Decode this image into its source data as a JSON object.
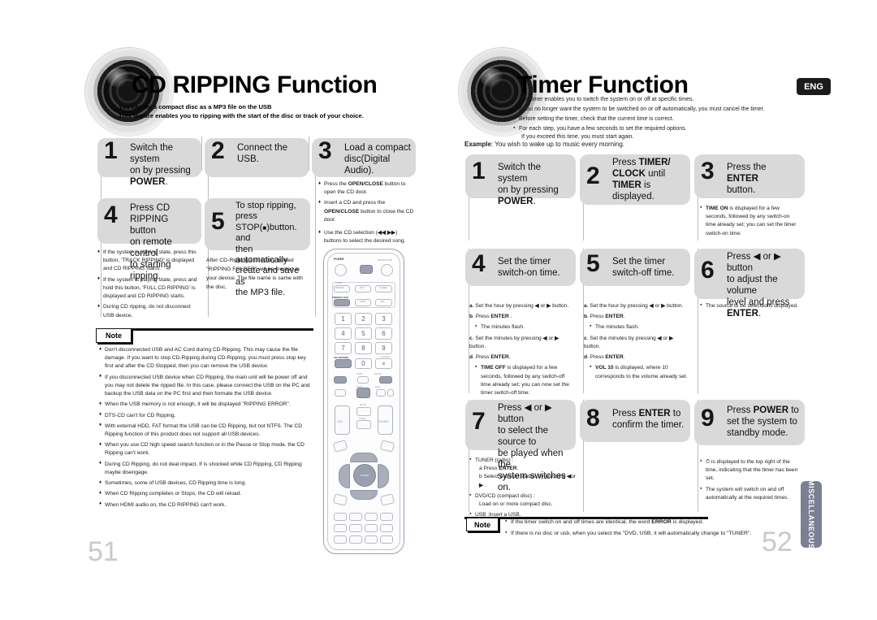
{
  "meta": {
    "lang_badge": "ENG",
    "side_tab": "MISCELLANEOUS"
  },
  "left_page": {
    "number": "51",
    "title": "CD RIPPING Function",
    "lead": [
      "You can rip a compact disc as a MP3 file on the USB",
      "This feature enables you to ripping with the start of the disc or track of your choice."
    ],
    "steps": [
      {
        "num": "1",
        "text": "Switch the system on by pressing POWER.",
        "bold": [
          "POWER"
        ]
      },
      {
        "num": "2",
        "text": "Connect the USB.",
        "bold": []
      },
      {
        "num": "3",
        "text": "Load a compact disc(Digital Audio).",
        "bold": []
      },
      {
        "num": "4",
        "text": "Press CD RIPPING button on remote control to starting ripping.",
        "bold": []
      },
      {
        "num": "5",
        "text": "To stop ripping, press STOP(■)button. and then automatically create and save as the MP3 file.",
        "bold": []
      }
    ],
    "step3_notes": [
      "Press the OPEN/CLOSE button to open the CD door.",
      "Insert a CD and press the OPEN/CLOSE button to close the CD door.",
      "Use the CD selection (◀◀ ▶▶) buttons to select the desired song."
    ],
    "step4_notes": [
      "If the system is playing state, press this button, 'TRACK RIPPING' is displayed and CD RIPPING starts.",
      "If the system is playing state, press and hold this button, 'FULL CD RIPPING' is displayed and CD RIPPING starts.",
      "During CD ripping, do not disconnect USB device."
    ],
    "step5_note": "After CD-Ripping,a directory named \"RIPPING FOLDER\" will be created in your device. The file name is same with the disc.",
    "note_label": "Note",
    "notes": [
      "Don't disconnected USB and AC Cord during CD-Ripping. This may cause the file damage. If you want to stop CD-Ripping during CD-Ripping, you must press stop key first and after the CD Stopped, then you can remove the USB device.",
      "If you disconnected USB device when CD Ripping, the main unit will be power off and you may not delete the ripped file. In this case, please connect the USB on the PC and backup the USB data on the PC first and then formate the USB device.",
      "When the USB memory is not enough, it will be displayed \"RIPPING ERROR\".",
      "DTS-CD can't for CD Ripping.",
      "With external HDD, FAT format the USB can be CD Ripping, but not NTFS. The CD Ripping function of this product does not support all USB devices.",
      "When you use CD high speed search function or in the Pause or Stop mode, the CD Ripping can't work.",
      "During CD Ripping, do not deal impact. If is shocked while CD Ripping, CD Ripping maybe disengage.",
      "Sometimes, some of USB devices, CD Ripping time is long.",
      "When CD Ripping completes or Stops, the CD will reload.",
      "When HDMI audio on, the CD RIPPING can't work."
    ]
  },
  "right_page": {
    "number": "52",
    "title": "Timer Function",
    "lead": [
      "The timer enables you to switch the system on or off at specific times.",
      "If you no longer want the system to be switched on or off automatically, you must cancel the timer.",
      "Before setting the timer, check that the current time is correct.",
      "For each step, you have a few seconds to set the required options.",
      "If you exceed this time, you must start again."
    ],
    "example_label": "Example",
    "example_text": ": You wish to wake up to music every morning.",
    "steps": [
      {
        "num": "1",
        "text": "Switch the system on by pressing POWER."
      },
      {
        "num": "2",
        "text": "Press TIMER/ CLOCK until TIMER is displayed."
      },
      {
        "num": "3",
        "text": "Press the ENTER button."
      },
      {
        "num": "4",
        "text": "Set the timer switch-on time."
      },
      {
        "num": "5",
        "text": "Set the timer switch-off time."
      },
      {
        "num": "6",
        "text": "Press ◀ or ▶ button to adjust the volume level and press ENTER."
      },
      {
        "num": "7",
        "text": "Press ◀ or ▶ button to select the source to be played when the system switches on."
      },
      {
        "num": "8",
        "text": "Press ENTER to confirm the timer."
      },
      {
        "num": "9",
        "text": "Press POWER to set the system to standby mode."
      }
    ],
    "step3_note": "TIME ON is displayed for a few seconds, followed by any switch-on time already set; you can set the timer switch-on time.",
    "step4_sub": [
      "a. Set the hour by pressing ◀ or ▶ button.",
      "b. Press ENTER .",
      "The minutes flash.",
      "c. Set the minutes by pressing ◀ or ▶ button.",
      "d. Press ENTER.",
      "TIME OFF is displayed for a few seconds, followed by any switch-off time already set; you can now set the timer switch-off time."
    ],
    "step5_sub": [
      "a. Set the hour by pressing ◀ or ▶ button.",
      "b. Press ENTER.",
      "The minutes flash.",
      "c. Set the minutes by pressing ◀ or ▶ button.",
      "d. Press ENTER.",
      "VOL 10 is displayed, where 10 corresponds to the volume already set."
    ],
    "step6_note": "The source to be selected is displayed.",
    "step7_sub": [
      "TUNER (radio) :",
      "a Press ENTER.",
      "b Select a preset station by pressing ◀ or ▶ .",
      "DVD/CD (compact disc) :",
      "Load on or more compact disc.",
      "USB :Insert a USB."
    ],
    "step9_sub": [
      "⏱ is displayed to the top right of the time, indicating that the timer has been set.",
      "The system will switch on and off automatically at the required times."
    ],
    "note_label": "Note",
    "notes": [
      "If the timer switch on and off times are identical, the word ERROR is displayed.",
      "If there is no disc or usb, when you select the \"DVD, USB, it will automatically change to \"TUNER\"."
    ]
  },
  "remote": {
    "power_label": "POWER",
    "labels": [
      "POWER",
      "TIMER ON/OFF",
      "TIMER/CLOCK",
      "DVD",
      "TUNER",
      "PORT",
      "AUX",
      "CD RIPPING",
      "DIMMER",
      "STEP",
      "PAUSE",
      "STOP",
      "PLAY",
      "VOL",
      "MUTE",
      "AUDIO",
      "TUNING",
      "DSP/EQ",
      "SLEEP",
      "P.BASS",
      "S.VOL",
      "ENTER",
      "RETURN",
      "MENU",
      "INFO",
      "SOUND",
      "REPEAT",
      "TUNER MEMORY",
      "SUBTITLE",
      "ZOOM",
      "ECHO",
      "MO/ST"
    ],
    "numbers": [
      "1",
      "2",
      "3",
      "4",
      "5",
      "6",
      "7",
      "8",
      "9",
      "0"
    ]
  }
}
